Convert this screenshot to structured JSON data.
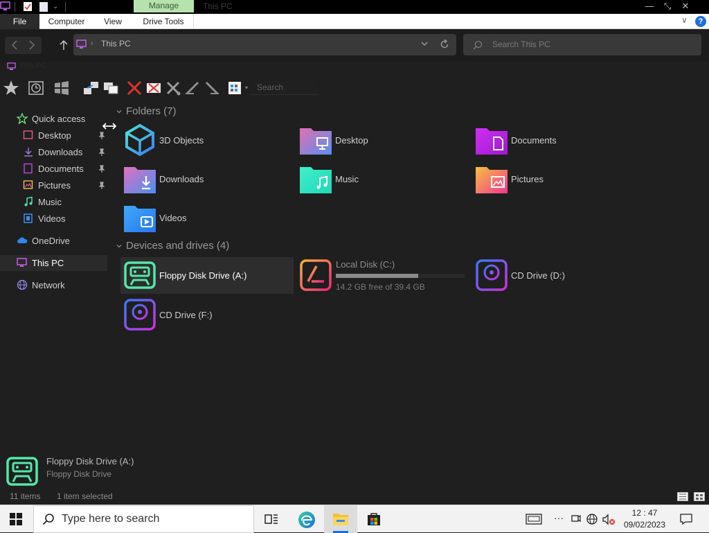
{
  "window": {
    "title": "This PC",
    "contextual_tab": "Manage",
    "min_glyph": "—",
    "restore_glyph": "⤡",
    "close_glyph": "✕"
  },
  "ribbon": {
    "tabs": [
      "File",
      "Computer",
      "View",
      "Drive Tools"
    ],
    "collapse_glyph": "∨",
    "help_glyph": "?"
  },
  "address": {
    "path": "This PC",
    "search_placeholder": "Search This PC"
  },
  "breadcrumb_tab": "This PC",
  "toolbar": {
    "search_placeholder": "Search"
  },
  "sidebar": {
    "quick_access": "Quick access",
    "pinned": [
      {
        "label": "Desktop",
        "icon": "desktop-icon",
        "color": "#e0608a"
      },
      {
        "label": "Downloads",
        "icon": "downloads-icon",
        "color": "#9a7adf"
      },
      {
        "label": "Documents",
        "icon": "documents-icon",
        "color": "#b84ce0"
      },
      {
        "label": "Pictures",
        "icon": "pictures-icon",
        "color": "#f0b85a"
      }
    ],
    "library": [
      {
        "label": "Music",
        "icon": "music-icon",
        "color": "#4fe0b0"
      },
      {
        "label": "Videos",
        "icon": "videos-icon",
        "color": "#3b8ff0"
      }
    ],
    "onedrive": "OneDrive",
    "this_pc": "This PC",
    "network": "Network"
  },
  "folders_section": {
    "title": "Folders (7)",
    "items": [
      {
        "label": "3D Objects",
        "icon": "3d-objects-icon"
      },
      {
        "label": "Desktop",
        "icon": "desktop-folder-icon"
      },
      {
        "label": "Documents",
        "icon": "documents-folder-icon"
      },
      {
        "label": "Downloads",
        "icon": "downloads-folder-icon"
      },
      {
        "label": "Music",
        "icon": "music-folder-icon"
      },
      {
        "label": "Pictures",
        "icon": "pictures-folder-icon"
      },
      {
        "label": "Videos",
        "icon": "videos-folder-icon"
      }
    ]
  },
  "drives_section": {
    "title": "Devices and drives (4)",
    "items": [
      {
        "label": "Floppy Disk Drive (A:)",
        "icon": "floppy-drive-icon",
        "selected": true
      },
      {
        "label": "Local Disk (C:)",
        "icon": "local-disk-icon",
        "free_text": "14.2 GB free of 39.4 GB",
        "used_fraction": 0.64
      },
      {
        "label": "CD Drive (D:)",
        "icon": "cd-drive-icon"
      },
      {
        "label": "CD Drive (F:)",
        "icon": "cd-drive-icon"
      }
    ]
  },
  "details": {
    "name": "Floppy Disk Drive (A:)",
    "type": "Floppy Disk Drive"
  },
  "status": {
    "item_count": "11 items",
    "selection": "1 item selected"
  },
  "taskbar": {
    "search_placeholder": "Type here to search",
    "time": "12 : 47",
    "date": "09/02/2023",
    "overflow_glyph": "···"
  }
}
